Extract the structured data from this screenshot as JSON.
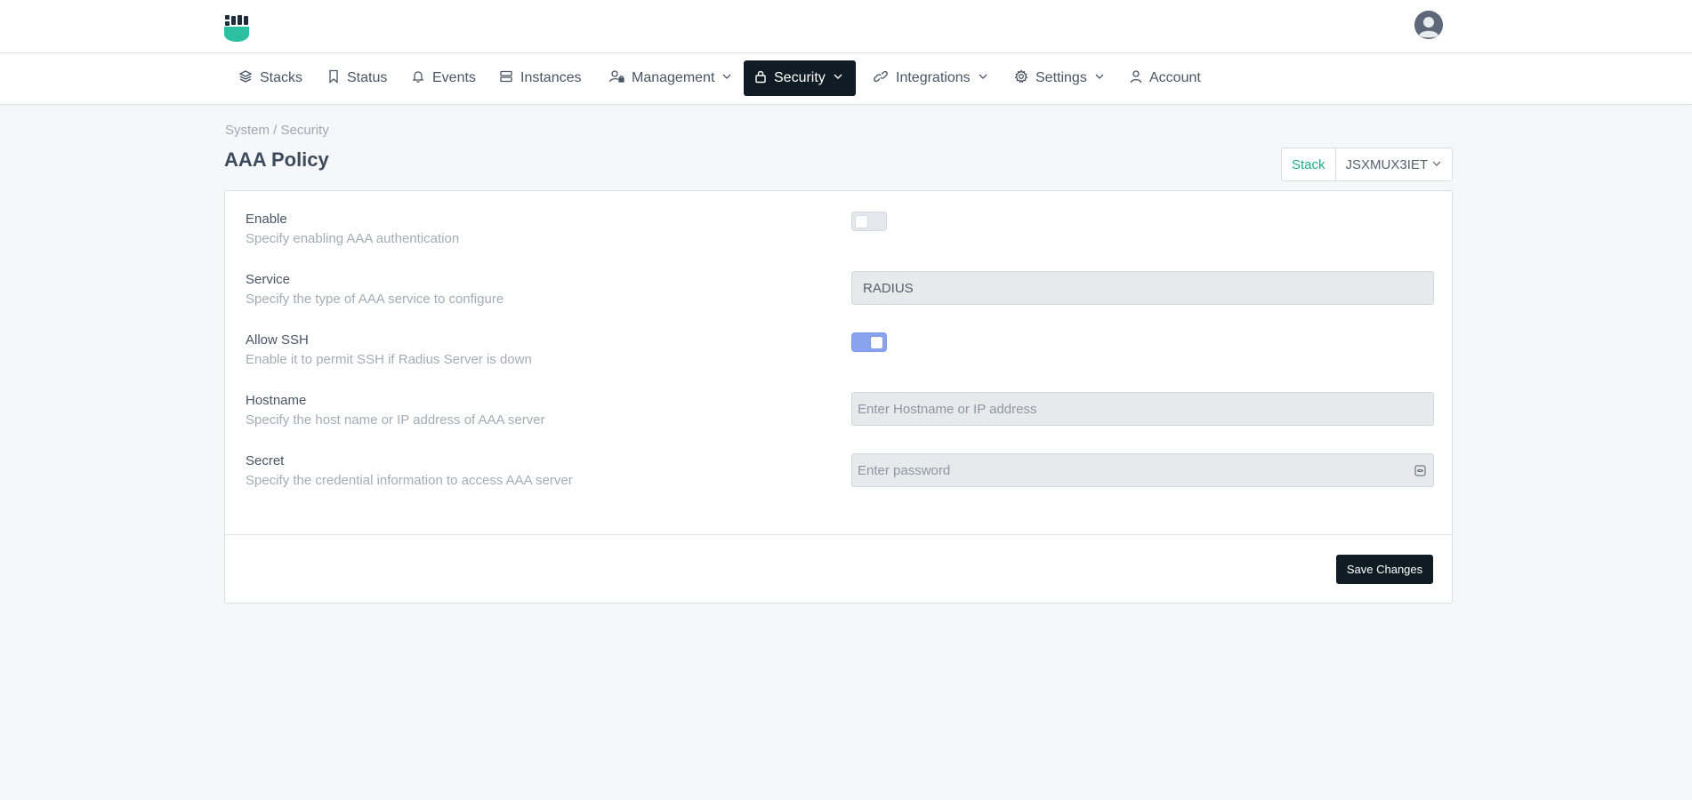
{
  "app": {
    "logo": "fist-logo-icon",
    "avatar": "user-avatar"
  },
  "nav": {
    "items": [
      {
        "label": "Stacks",
        "icon": "layers-icon"
      },
      {
        "label": "Status",
        "icon": "bookmark-icon"
      },
      {
        "label": "Events",
        "icon": "bell-icon"
      },
      {
        "label": "Instances",
        "icon": "server-icon"
      },
      {
        "label": "Management",
        "icon": "user-lock-icon",
        "dropdown": true
      },
      {
        "label": "Security",
        "icon": "lock-icon",
        "dropdown": true,
        "active": true
      },
      {
        "label": "Integrations",
        "icon": "link-icon",
        "dropdown": true
      },
      {
        "label": "Settings",
        "icon": "gear-icon",
        "dropdown": true
      },
      {
        "label": "Account",
        "icon": "user-icon"
      }
    ]
  },
  "breadcrumb": "System / Security",
  "page": {
    "title": "AAA Policy"
  },
  "stack": {
    "label": "Stack",
    "value": "JSXMUX3IET"
  },
  "form": {
    "enable": {
      "label": "Enable",
      "description": "Specify enabling AAA authentication",
      "value": false
    },
    "service": {
      "label": "Service",
      "description": "Specify the type of AAA service to configure",
      "value": "RADIUS"
    },
    "allow_ssh": {
      "label": "Allow SSH",
      "description": "Enable it to permit SSH if Radius Server is down",
      "value": true
    },
    "hostname": {
      "label": "Hostname",
      "description": "Specify the host name or IP address of AAA server",
      "placeholder": "Enter Hostname or IP address"
    },
    "secret": {
      "label": "Secret",
      "description": "Specify the credential information to access AAA server",
      "placeholder": "Enter password"
    }
  },
  "actions": {
    "save_label": "Save Changes"
  },
  "colors": {
    "accent": "#1dae8c",
    "dark": "#0f1c24",
    "toggle_on": "#8aa3ee"
  }
}
